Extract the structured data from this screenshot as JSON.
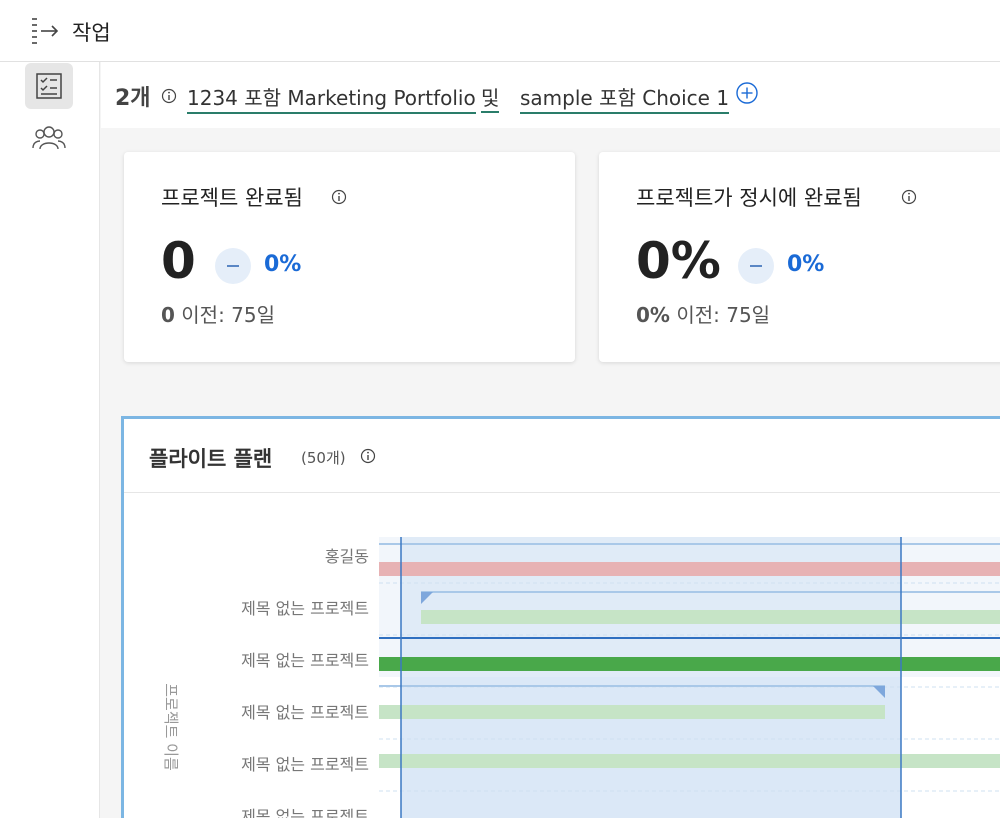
{
  "header": {
    "title": "작업",
    "nav_icon": "panel-toggle-icon"
  },
  "sidebar": {
    "items": [
      {
        "icon": "task-list-icon",
        "active": true
      },
      {
        "icon": "users-icon",
        "active": false
      }
    ]
  },
  "filters": {
    "count": "2개",
    "items": [
      "1234 포함 Marketing Portfolio",
      "sample 포함 Choice 1"
    ],
    "conjunction": "및",
    "add_icon": "plus-circle-icon"
  },
  "cards": [
    {
      "title": "프로젝트 완료됨",
      "value": "0",
      "change": "0%",
      "prev_value": "0",
      "prev_label": "이전: 75일"
    },
    {
      "title": "프로젝트가 정시에 완료됨",
      "value": "0%",
      "change": "0%",
      "prev_value": "0%",
      "prev_label": "이전: 75일"
    }
  ],
  "chart": {
    "title": "플라이트 플랜",
    "subtitle": "(50개)",
    "y_axis_label": "프로젝트 이름",
    "rows": [
      "홍길동",
      "제목 없는 프로젝트",
      "제목 없는 프로젝트",
      "제목 없는 프로젝트",
      "제목 없는 프로젝트",
      "제목 없는 프로젝트"
    ],
    "colors": {
      "red": "#f2b3b3",
      "light_green": "#c6e4c6",
      "dark_green": "#49a84a",
      "selection": "#dbe8f7",
      "line": "#3b78c3"
    }
  }
}
